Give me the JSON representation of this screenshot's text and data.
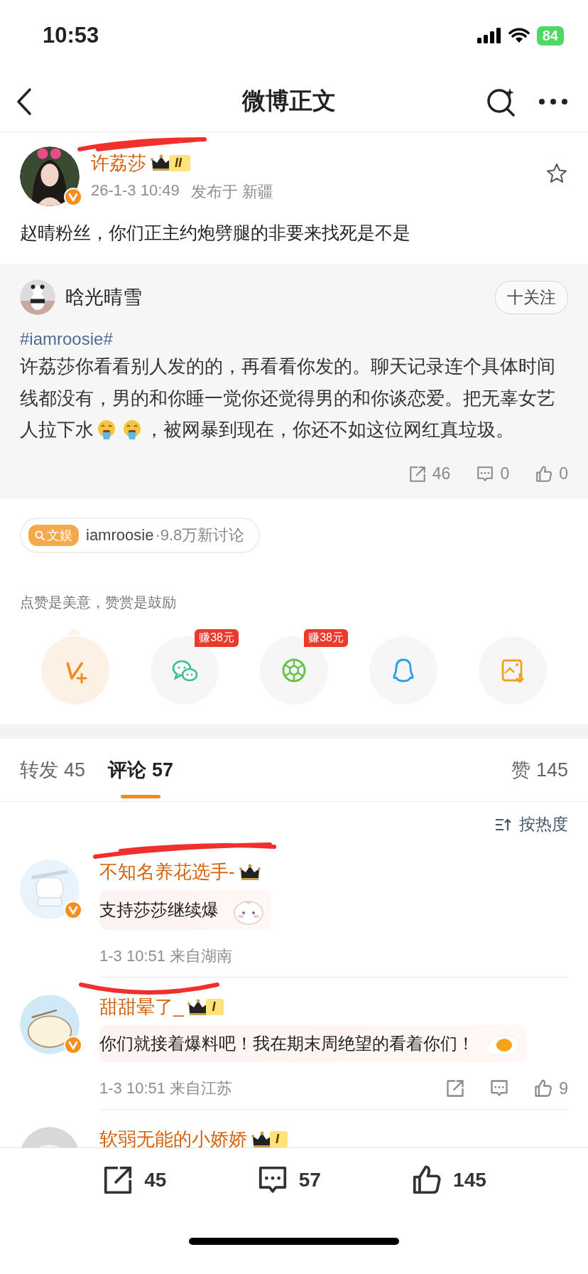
{
  "status_bar": {
    "time": "10:53",
    "battery": "84"
  },
  "nav": {
    "title": "微博正文"
  },
  "post": {
    "author": {
      "name": "许荔莎",
      "level": "II",
      "verified": true,
      "scribbled": true
    },
    "time": "26-1-3 10:49",
    "location": "发布于 新疆",
    "starred": false,
    "text": "赵晴粉丝，你们正主约炮劈腿的非要来找死是不是"
  },
  "repost": {
    "author": "晗光晴雪",
    "follow_label": "十关注",
    "hashtag": "#iamroosie#",
    "segments": [
      {
        "kind": "text",
        "text": "许荔莎你看看别人发的的，再看看你发的。聊天记录连个具体时间线都没有，男的和你睡一觉你还觉得男的和你谈恋爱。把无辜女艺人拉下水"
      },
      {
        "kind": "emoji"
      },
      {
        "kind": "emoji"
      },
      {
        "kind": "text",
        "text": "，被网暴到现在，你还不如这位网红真垃圾。"
      }
    ],
    "reposts": "46",
    "comments": "0",
    "likes": "0"
  },
  "topic": {
    "tag": "文娱",
    "name": "iamroosie",
    "stat": "·9.8万新讨论"
  },
  "reward_hint": "点赞是美意，赞赏是鼓励",
  "share_targets": [
    {
      "kind": "vip"
    },
    {
      "kind": "wechat",
      "badge": "赚38元"
    },
    {
      "kind": "moments",
      "badge": "赚38元"
    },
    {
      "kind": "qq"
    },
    {
      "kind": "save"
    }
  ],
  "tabs": [
    {
      "label": "转发",
      "count": "45",
      "selected": false
    },
    {
      "label": "评论",
      "count": "57",
      "selected": true
    },
    {
      "label": "赞",
      "count": "145",
      "selected": false
    }
  ],
  "sort_label": "按热度",
  "comments": [
    {
      "name": "不知名养花选手-",
      "verified": true,
      "scribbled": true,
      "text": "支持莎莎继续爆",
      "meta": "1-3 10:51 来自湖南",
      "bubble": {
        "kind": "bunny"
      }
    },
    {
      "name": "甜甜晕了_",
      "level": "I",
      "verified": true,
      "scribbled": true,
      "text": "你们就接着爆料吧！我在期末周绝望的看着你们！",
      "meta": "1-3 10:51 来自江苏",
      "likes": "9",
      "bubble": {
        "kind": "egg"
      }
    },
    {
      "name": "软弱无能的小娇娇",
      "level": "I"
    }
  ],
  "bottom_bar": {
    "reposts": "45",
    "comments": "57",
    "likes": "145"
  }
}
